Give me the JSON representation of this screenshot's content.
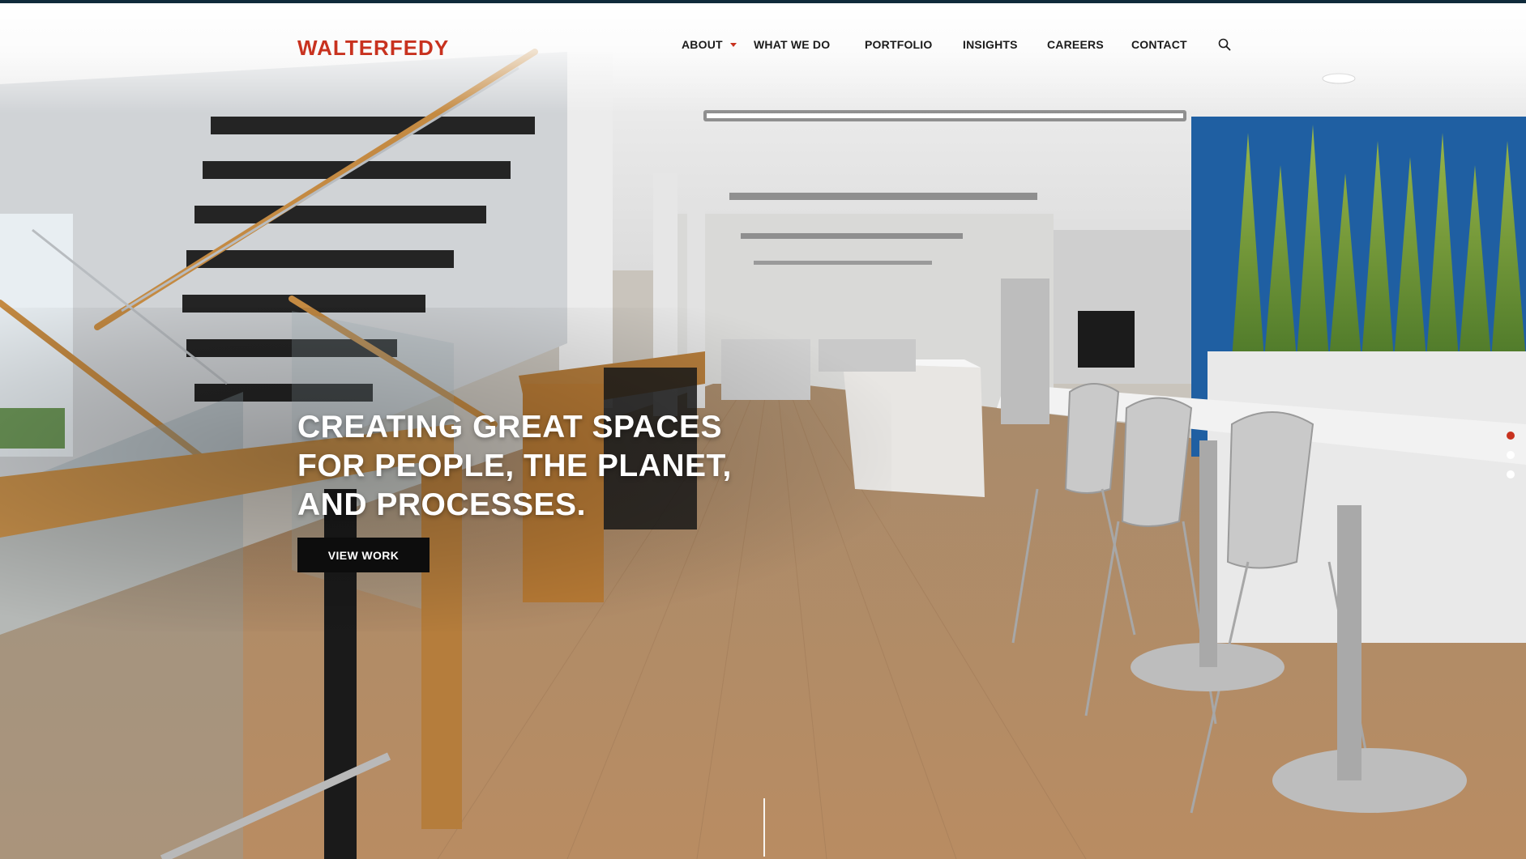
{
  "brand": {
    "logo_text": "WALTERFEDY",
    "logo_color": "#c8321f"
  },
  "nav": {
    "items": [
      {
        "label": "ABOUT",
        "has_dropdown": true
      },
      {
        "label": "WHAT WE DO"
      },
      {
        "label": "PORTFOLIO"
      },
      {
        "label": "INSIGHTS"
      },
      {
        "label": "CAREERS"
      },
      {
        "label": "CONTACT"
      }
    ],
    "search_icon": "search-icon",
    "dropdown_icon": "caret-down-icon"
  },
  "hero": {
    "headline_lines": [
      "CREATING GREAT SPACES",
      "FOR PEOPLE, THE PLANET,",
      "AND PROCESSES."
    ],
    "cta_label": "VIEW WORK"
  },
  "slider": {
    "slide_count": 3,
    "active_index": 0,
    "active_color": "#c8321f",
    "inactive_color": "#ffffff"
  }
}
